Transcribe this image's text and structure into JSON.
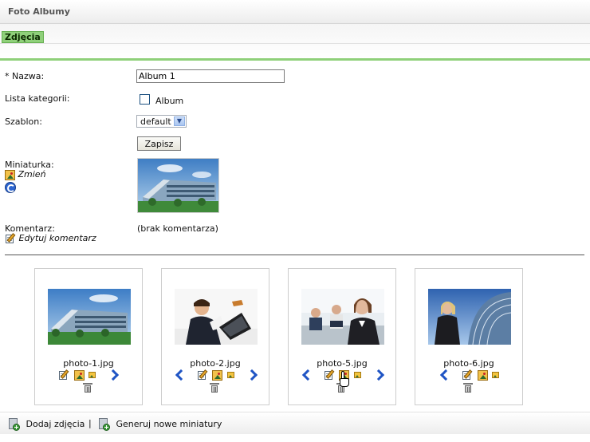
{
  "window": {
    "title": "Foto Albumy"
  },
  "tabs": [
    {
      "label": "Zdjęcia",
      "active": true
    }
  ],
  "form": {
    "name_label": "* Nazwa:",
    "name_value": "Album 1",
    "categories_label": "Lista kategorii:",
    "category_option": "Album",
    "category_checked": false,
    "template_label": "Szablon:",
    "template_value": "default",
    "save_button": "Zapisz",
    "thumbnail_label": "Miniaturka:",
    "change_link": "Zmień",
    "comment_label": "Komentarz:",
    "comment_value": "(brak komentarza)",
    "edit_comment_link": "Edytuj komentarz"
  },
  "photos": [
    {
      "filename": "photo-1.jpg",
      "has_prev": false,
      "has_next": true
    },
    {
      "filename": "photo-2.jpg",
      "has_prev": true,
      "has_next": true
    },
    {
      "filename": "photo-5.jpg",
      "has_prev": true,
      "has_next": true
    },
    {
      "filename": "photo-6.jpg",
      "has_prev": true,
      "has_next": false
    }
  ],
  "footer": {
    "add_photos": "Dodaj zdjęcia",
    "separator": "|",
    "generate_thumbnails": "Generuj nowe miniatury"
  },
  "colors": {
    "accent_green": "#8fd07a",
    "arrow_blue": "#1f54c4"
  }
}
